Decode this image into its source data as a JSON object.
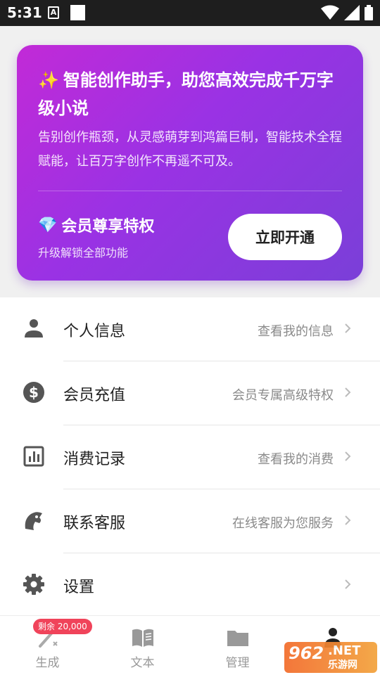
{
  "status_bar": {
    "time": "5:31",
    "notif_letter": "A"
  },
  "promo": {
    "sparkle_icon": "✨",
    "title": "智能创作助手，助您高效完成千万字级小说",
    "description": "告别创作瓶颈，从灵感萌芽到鸿篇巨制，智能技术全程赋能，让百万字创作不再遥不可及。",
    "vip_icon": "💎",
    "vip_title": "会员尊享特权",
    "vip_sub": "升级解锁全部功能",
    "cta": "立即开通"
  },
  "menu": {
    "items": [
      {
        "icon": "person-icon",
        "label": "个人信息",
        "hint": "查看我的信息"
      },
      {
        "icon": "dollar-icon",
        "label": "会员充值",
        "hint": "会员专属高级特权"
      },
      {
        "icon": "bar-chart-icon",
        "label": "消费记录",
        "hint": "查看我的消费"
      },
      {
        "icon": "support-icon",
        "label": "联系客服",
        "hint": "在线客服为您服务"
      },
      {
        "icon": "gear-icon",
        "label": "设置",
        "hint": ""
      }
    ]
  },
  "tabbar": {
    "badge": "剩余 20,000",
    "tabs": [
      {
        "icon": "wand-icon",
        "label": "生成"
      },
      {
        "icon": "book-icon",
        "label": "文本"
      },
      {
        "icon": "folder-icon",
        "label": "管理"
      },
      {
        "icon": "user-icon",
        "label": ""
      }
    ]
  },
  "watermark": {
    "number": "962",
    "suffix": ".NET",
    "name": "乐游网"
  },
  "colors": {
    "card_start": "#c22ad7",
    "card_end": "#7a3fd8",
    "badge": "#f0435a",
    "icon": "#555555"
  }
}
